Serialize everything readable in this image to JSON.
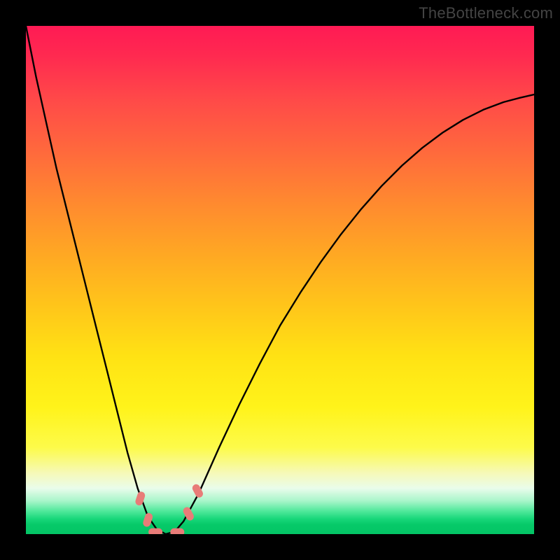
{
  "watermark": {
    "text": "TheBottleneck.com"
  },
  "chart_data": {
    "type": "line",
    "title": "",
    "xlabel": "",
    "ylabel": "",
    "x_range": [
      0,
      1
    ],
    "y_range": [
      0,
      1
    ],
    "series": [
      {
        "name": "bottleneck-curve",
        "description": "V-shaped curve: steep descent from top-left, minimum near x≈0.27 at y≈0, asymmetric rise toward top-right (reaches ~0.85 at x=1).",
        "color": "#000000",
        "x": [
          0.0,
          0.02,
          0.04,
          0.06,
          0.08,
          0.1,
          0.12,
          0.14,
          0.16,
          0.18,
          0.2,
          0.22,
          0.24,
          0.257,
          0.275,
          0.293,
          0.31,
          0.34,
          0.38,
          0.42,
          0.46,
          0.5,
          0.54,
          0.58,
          0.62,
          0.66,
          0.7,
          0.74,
          0.78,
          0.82,
          0.86,
          0.9,
          0.94,
          0.97,
          1.0
        ],
        "y": [
          1.0,
          0.9,
          0.81,
          0.72,
          0.64,
          0.56,
          0.48,
          0.4,
          0.32,
          0.24,
          0.16,
          0.09,
          0.035,
          0.01,
          0.0,
          0.005,
          0.025,
          0.08,
          0.17,
          0.255,
          0.335,
          0.41,
          0.475,
          0.535,
          0.59,
          0.64,
          0.685,
          0.725,
          0.76,
          0.79,
          0.815,
          0.835,
          0.85,
          0.858,
          0.865
        ]
      }
    ],
    "markers": [
      {
        "name": "marker-left-upper",
        "x": 0.225,
        "y": 0.07,
        "color": "#e87c78"
      },
      {
        "name": "marker-left-lower",
        "x": 0.24,
        "y": 0.028,
        "color": "#e87c78"
      },
      {
        "name": "marker-bottom-left",
        "x": 0.255,
        "y": 0.004,
        "color": "#e87c78"
      },
      {
        "name": "marker-bottom-right",
        "x": 0.298,
        "y": 0.004,
        "color": "#e87c78"
      },
      {
        "name": "marker-right-lower",
        "x": 0.32,
        "y": 0.04,
        "color": "#e87c78"
      },
      {
        "name": "marker-right-upper",
        "x": 0.338,
        "y": 0.085,
        "color": "#e87c78"
      }
    ],
    "background_gradient": {
      "orientation": "vertical",
      "stops": [
        {
          "pos": 0.0,
          "color": "#ff1a54"
        },
        {
          "pos": 0.25,
          "color": "#ff6a3c"
        },
        {
          "pos": 0.55,
          "color": "#ffc51a"
        },
        {
          "pos": 0.8,
          "color": "#fdfb4a"
        },
        {
          "pos": 0.93,
          "color": "#a7f5c9"
        },
        {
          "pos": 1.0,
          "color": "#04c566"
        }
      ]
    }
  }
}
